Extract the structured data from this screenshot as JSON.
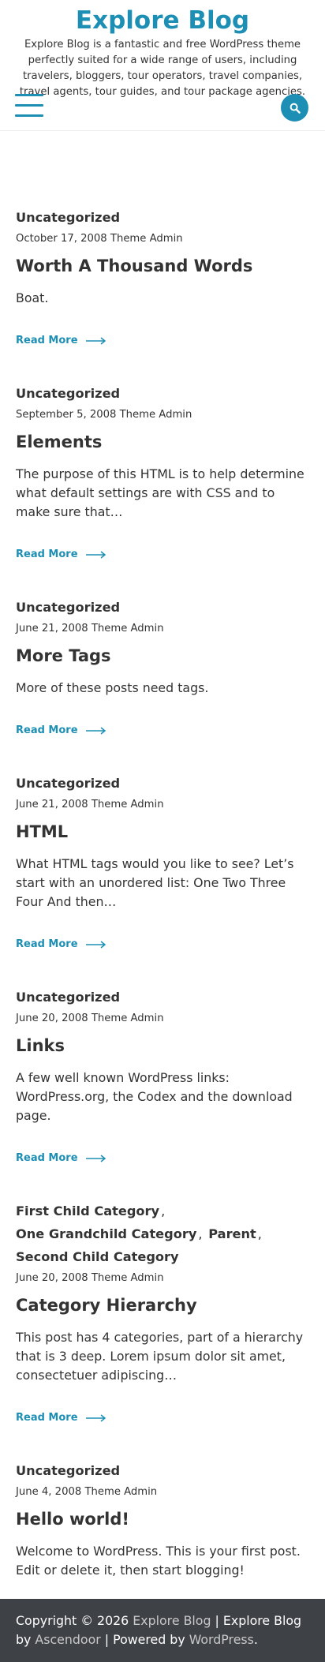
{
  "header": {
    "site_title": "Explore Blog",
    "site_description": "Explore Blog is a fantastic and free WordPress theme perfectly suited for a wide range of users, including travelers, bloggers, tour operators, travel companies, travel agents, tour guides, and tour package agencies.",
    "menu_icon": "hamburger-menu-icon",
    "search_icon": "search-icon",
    "accent_color": "#1e8fb4"
  },
  "read_more_label": "Read More",
  "posts": [
    {
      "cat1": "Uncategorized",
      "date": "October 17, 2008",
      "author": "Theme Admin",
      "title": "Worth A Thousand Words",
      "excerpt": "Boat."
    },
    {
      "cat1": "Uncategorized",
      "date": "September 5, 2008",
      "author": "Theme Admin",
      "title": "Elements",
      "excerpt": "The purpose of this HTML is to help determine what default settings are with CSS and to make sure that…"
    },
    {
      "cat1": "Uncategorized",
      "date": "June 21, 2008",
      "author": "Theme Admin",
      "title": "More Tags",
      "excerpt": "More of these posts need tags."
    },
    {
      "cat1": "Uncategorized",
      "date": "June 21, 2008",
      "author": "Theme Admin",
      "title": "HTML",
      "excerpt": "What HTML tags would you like to see? Let’s start with an unordered list: One Two Three Four And then…"
    },
    {
      "cat1": "Uncategorized",
      "date": "June 20, 2008",
      "author": "Theme Admin",
      "title": "Links",
      "excerpt": "A few well known WordPress links: WordPress.org, the Codex and the download page."
    },
    {
      "cat1": "First Child Category",
      "cat2": "One Grandchild Category",
      "cat3": "Parent",
      "cat4": "Second Child Category",
      "date": "June 20, 2008",
      "author": "Theme Admin",
      "title": "Category Hierarchy",
      "excerpt": "This post has 4 categories, part of a hierarchy that is 3 deep. Lorem ipsum dolor sit amet, consectetuer adipiscing…"
    },
    {
      "cat1": "Uncategorized",
      "date": "June 4, 2008",
      "author": "Theme Admin",
      "title": "Hello world!",
      "excerpt": "Welcome to WordPress. This is your first post. Edit or delete it, then start blogging!"
    }
  ],
  "footer": {
    "copyright": "Copyright © 2026",
    "site_link": "Explore Blog",
    "sep1": "| Explore Blog by",
    "author_link": "Ascendoor",
    "sep2": "| Powered by",
    "wp_link": "WordPress",
    "end": ".",
    "background": "#3e4146"
  }
}
